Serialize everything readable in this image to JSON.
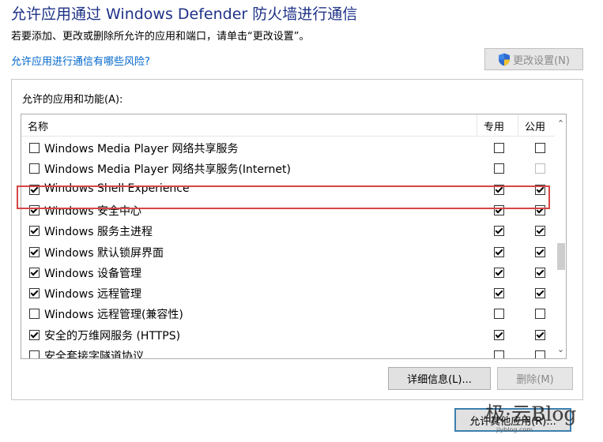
{
  "header": {
    "title": "允许应用通过 Windows Defender 防火墙进行通信",
    "subtitle": "若要添加、更改或删除所允许的应用和端口，请单击“更改设置”。",
    "risk_link": "允许应用进行通信有哪些风险?",
    "change_settings_label": "更改设置(N)",
    "change_settings_icon": "uac-shield-icon"
  },
  "apps_group": {
    "label": "允许的应用和功能(A):",
    "columns": {
      "name": "名称",
      "private": "专用",
      "public": "公用"
    },
    "rows": [
      {
        "name": "Windows Media Player 网络共享服务",
        "enabled": false,
        "private": false,
        "public": false
      },
      {
        "name": "Windows Media Player 网络共享服务(Internet)",
        "enabled": false,
        "private": false,
        "public": false,
        "public_disabled": true
      },
      {
        "name": "Windows Shell Experience",
        "enabled": true,
        "private": true,
        "public": true
      },
      {
        "name": "Windows 安全中心",
        "enabled": true,
        "private": true,
        "public": true
      },
      {
        "name": "Windows 服务主进程",
        "enabled": true,
        "private": true,
        "public": true,
        "highlighted": true
      },
      {
        "name": "Windows 默认锁屏界面",
        "enabled": true,
        "private": true,
        "public": true
      },
      {
        "name": "Windows 设备管理",
        "enabled": true,
        "private": true,
        "public": true
      },
      {
        "name": "Windows 远程管理",
        "enabled": true,
        "private": true,
        "public": true
      },
      {
        "name": "Windows 远程管理(兼容性)",
        "enabled": false,
        "private": false,
        "public": false
      },
      {
        "name": "安全的万维网服务 (HTTPS)",
        "enabled": true,
        "private": true,
        "public": true
      },
      {
        "name": "安全套接字隧道协议",
        "enabled": false,
        "private": false,
        "public": false
      }
    ],
    "details_label": "详细信息(L)...",
    "delete_label": "删除(M)"
  },
  "footer": {
    "allow_other_label": "允许其他应用(R)..."
  },
  "watermark": {
    "brand": "极·云Blog",
    "url": "jiyblog.com"
  },
  "colors": {
    "title": "#1e3287",
    "link": "#0066cc",
    "highlight": "#d64545"
  }
}
